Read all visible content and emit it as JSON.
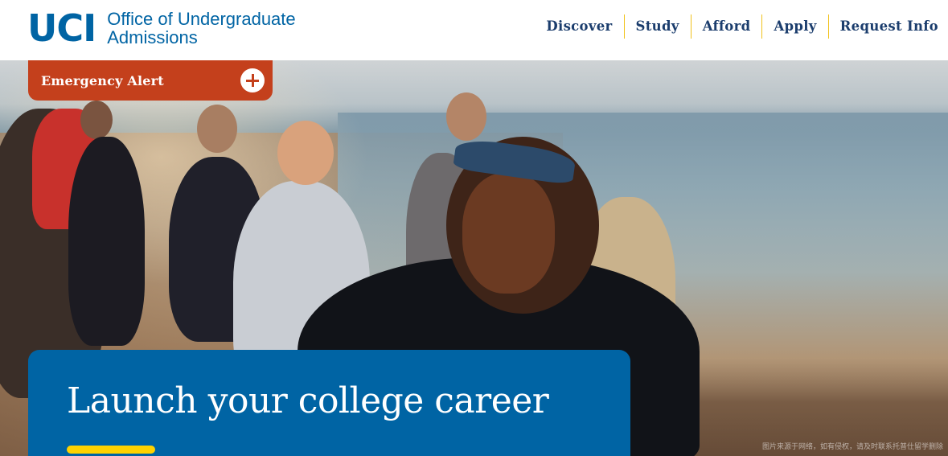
{
  "header": {
    "logo_mark": "UCI",
    "logo_line1": "Office of Undergraduate",
    "logo_line2": "Admissions",
    "nav": [
      "Discover",
      "Study",
      "Afford",
      "Apply",
      "Request Info"
    ]
  },
  "alert": {
    "label": "Emergency Alert",
    "icon": "plus-circle-icon",
    "color": "#c4401c"
  },
  "hero": {
    "image_icon": "hero-photo",
    "headline": "Launch your college career",
    "accent_bar_color": "#ffd200",
    "panel_color": "#0064a4",
    "watermark": "图片来源于网络，如有侵权，请及时联系托普仕留学删除"
  },
  "colors": {
    "brand_blue": "#0064a4",
    "nav_text": "#1b3d6d",
    "divider_gold": "#f1c21c"
  }
}
